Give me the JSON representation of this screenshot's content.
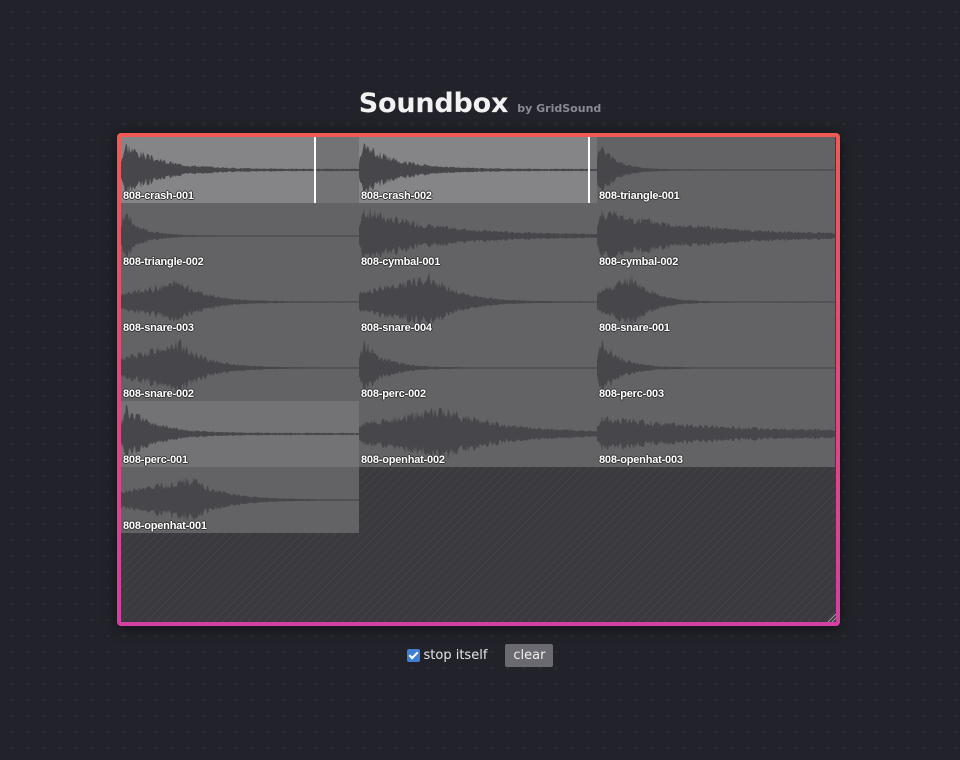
{
  "header": {
    "title": "Soundbox",
    "subtitle": "by GridSound"
  },
  "samples": [
    {
      "name": "808-crash-001",
      "playing": true,
      "progress": 0.82
    },
    {
      "name": "808-crash-002",
      "playing": true,
      "progress": 0.97
    },
    {
      "name": "808-triangle-001"
    },
    {
      "name": "808-triangle-002"
    },
    {
      "name": "808-cymbal-001"
    },
    {
      "name": "808-cymbal-002"
    },
    {
      "name": "808-snare-003"
    },
    {
      "name": "808-snare-004"
    },
    {
      "name": "808-snare-001"
    },
    {
      "name": "808-snare-002"
    },
    {
      "name": "808-perc-002"
    },
    {
      "name": "808-perc-003"
    },
    {
      "name": "808-perc-001"
    },
    {
      "name": "808-openhat-002"
    },
    {
      "name": "808-openhat-003"
    },
    {
      "name": "808-openhat-001"
    }
  ],
  "controls": {
    "stop_itself_label": "stop itself",
    "stop_itself_checked": true,
    "clear_label": "clear"
  },
  "colors": {
    "frame_top": "#f05a55",
    "frame_bottom": "#d63fa3",
    "waveform": "#47474b",
    "checkbox": "#3e7fd6"
  }
}
